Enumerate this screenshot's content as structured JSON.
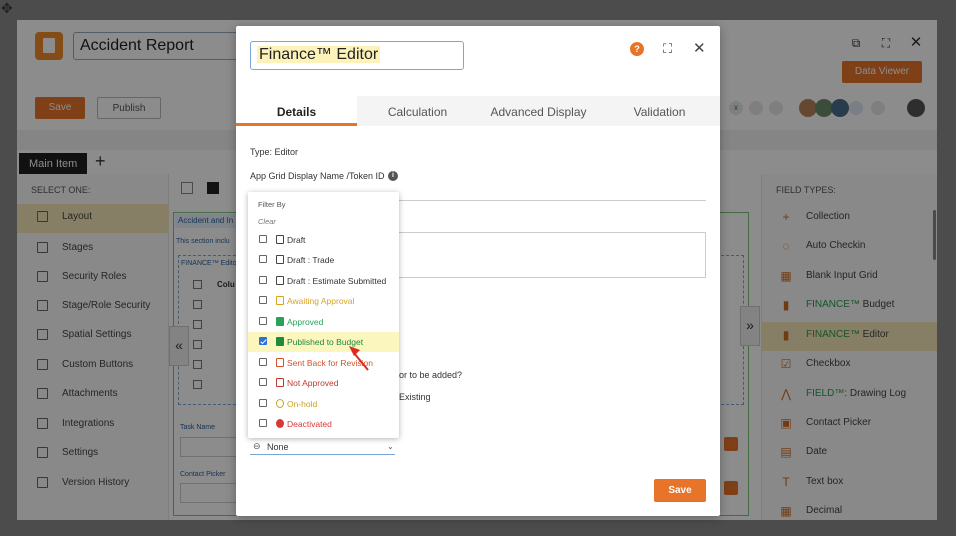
{
  "app": {
    "title": "Accident Report",
    "data_viewer_label": "Data Viewer",
    "save_label": "Save",
    "publish_label": "Publish",
    "main_item_tab": "Main Item",
    "select_one_label": "SELECT ONE:",
    "field_types_label": "FIELD TYPES:",
    "sidebar": [
      {
        "label": "Layout",
        "icon": "layout-icon"
      },
      {
        "label": "Stages",
        "icon": "stages-icon"
      },
      {
        "label": "Security Roles",
        "icon": "lock-icon"
      },
      {
        "label": "Stage/Role Security",
        "icon": "user-lock-icon"
      },
      {
        "label": "Spatial Settings",
        "icon": "map-settings-icon"
      },
      {
        "label": "Custom Buttons",
        "icon": "custom-button-icon"
      },
      {
        "label": "Attachments",
        "icon": "paperclip-icon"
      },
      {
        "label": "Integrations",
        "icon": "integrations-icon"
      },
      {
        "label": "Settings",
        "icon": "gears-icon"
      },
      {
        "label": "Version History",
        "icon": "version-history-icon"
      }
    ],
    "field_types": [
      {
        "label": "Collection",
        "icon": "plus-icon"
      },
      {
        "label": "Auto Checkin",
        "icon": "auto-checkin-icon"
      },
      {
        "label": "Blank Input Grid",
        "icon": "grid-icon"
      },
      {
        "label": "FINANCE™ Budget",
        "icon": "finance-doc-icon",
        "brand": "FINANCE™",
        "rest": " Budget"
      },
      {
        "label": "FINANCE™ Editor",
        "icon": "finance-doc-icon",
        "brand": "FINANCE™",
        "rest": " Editor"
      },
      {
        "label": "Checkbox",
        "icon": "checkbox-icon"
      },
      {
        "label": "FIELD™: Drawing Log",
        "icon": "drawing-log-icon",
        "brand": "FIELD™",
        "rest": ": Drawing Log"
      },
      {
        "label": "Contact Picker",
        "icon": "contact-icon"
      },
      {
        "label": "Date",
        "icon": "calendar-icon"
      },
      {
        "label": "Text box",
        "icon": "text-box-icon"
      },
      {
        "label": "Decimal",
        "icon": "decimal-icon"
      }
    ],
    "canvas": {
      "section_title": "Accident and In",
      "section_note": "This section inclu",
      "finance_label": "FINANCE™ Edito",
      "column_label": "Colu",
      "task_name_label": "Task Name",
      "contact_picker_label": "Contact Picker"
    }
  },
  "modal": {
    "title": "Finance™ Editor",
    "tabs": [
      "Details",
      "Calculation",
      "Advanced Display",
      "Validation"
    ],
    "active_tab": "Details",
    "type_text": "Type: Editor",
    "display_name_label": "App Grid Display Name /Token ID",
    "question_fragment": "or to be added?",
    "existing_fragment": "Existing",
    "select_value": "None",
    "save_label": "Save",
    "help_icon": "?",
    "colors": {
      "accent": "#e8742a",
      "selected_row": "#fbf6bd"
    }
  },
  "filter_dropdown": {
    "header": "Filter By",
    "clear_label": "Clear",
    "options": [
      {
        "label": "Draft",
        "checked": false,
        "color": "#333333",
        "icon": "draft-icon"
      },
      {
        "label": "Draft : Trade",
        "checked": false,
        "color": "#333333",
        "icon": "draft-icon"
      },
      {
        "label": "Draft : Estimate Submitted",
        "checked": false,
        "color": "#333333",
        "icon": "draft-icon"
      },
      {
        "label": "Awaiting Approval",
        "checked": false,
        "color": "#d8a423",
        "icon": "hourglass-icon"
      },
      {
        "label": "Approved",
        "checked": false,
        "color": "#27a35a",
        "icon": "approved-doc-icon"
      },
      {
        "label": "Published to Budget",
        "checked": true,
        "color": "#1f8a3c",
        "icon": "published-doc-icon"
      },
      {
        "label": "Sent Back for Revision",
        "checked": false,
        "color": "#d2532a",
        "icon": "sent-back-icon"
      },
      {
        "label": "Not Approved",
        "checked": false,
        "color": "#c0392b",
        "icon": "not-approved-icon"
      },
      {
        "label": "On-hold",
        "checked": false,
        "color": "#c9a21f",
        "icon": "on-hold-icon"
      },
      {
        "label": "Deactivated",
        "checked": false,
        "color": "#d93838",
        "icon": "deactivated-icon"
      }
    ]
  }
}
